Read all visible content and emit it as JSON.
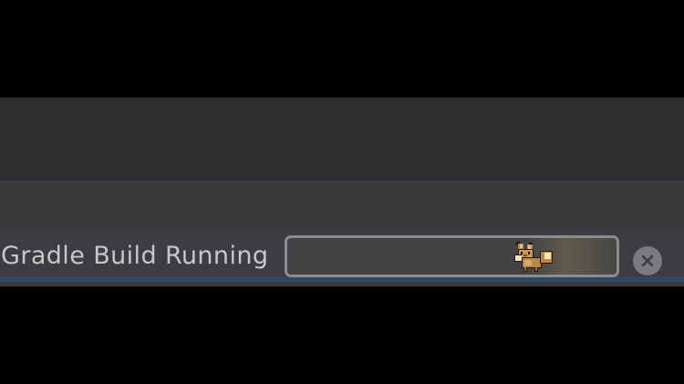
{
  "status_bar": {
    "task_label": "Gradle Build Running",
    "progress": {
      "fraction": 0.75,
      "indicator_icon": "eevee-pixel-mascot-icon",
      "border_color": "#8b8c8e",
      "fill_color": "#414244"
    },
    "cancel_icon": "close-circle-icon",
    "accent_line_color": "#2d4a6a"
  },
  "theme": {
    "window_background": "#2f2f31",
    "panel_background": "#3a3a3d",
    "text_color": "#c7c7c7"
  }
}
